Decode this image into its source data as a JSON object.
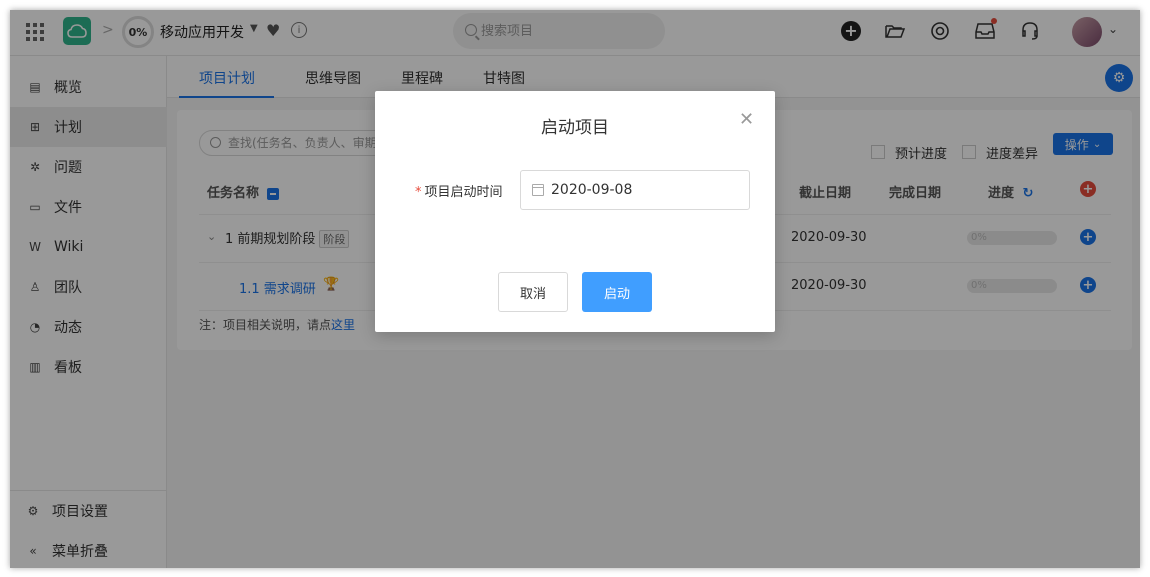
{
  "header": {
    "progress": "0%",
    "project_name": "移动应用开发",
    "search_placeholder": "搜索项目"
  },
  "sidebar": {
    "items": [
      {
        "label": "概览",
        "icon": "overview-icon"
      },
      {
        "label": "计划",
        "icon": "plan-icon",
        "active": true
      },
      {
        "label": "问题",
        "icon": "bug-icon"
      },
      {
        "label": "文件",
        "icon": "folder-icon"
      },
      {
        "label": "Wiki",
        "icon": "wiki-icon"
      },
      {
        "label": "团队",
        "icon": "team-icon"
      },
      {
        "label": "动态",
        "icon": "activity-icon"
      },
      {
        "label": "看板",
        "icon": "board-icon"
      }
    ],
    "settings_label": "项目设置",
    "collapse_label": "菜单折叠"
  },
  "tabs": [
    "项目计划",
    "思维导图",
    "里程碑",
    "甘特图"
  ],
  "plan": {
    "task_search_placeholder": "查找(任务名、负责人、审期",
    "show_planned_progress": "预计进度",
    "show_progress_diff": "进度差异",
    "operations_label": "操作",
    "columns": {
      "task_name": "任务名称",
      "due_date": "截止日期",
      "completion_date": "完成日期",
      "progress": "进度"
    },
    "rows": [
      {
        "name": "1 前期规划阶段",
        "badge": "阶段",
        "due": "2020-09-30",
        "progress": "0%"
      },
      {
        "name": "1.1 需求调研",
        "due": "2020-09-30",
        "progress": "0%"
      }
    ],
    "note_prefix": "注：项目相关说明，请点",
    "note_link": "这里"
  },
  "modal": {
    "title": "启动项目",
    "field_label": "项目启动时间",
    "required_mark": "*",
    "date_value": "2020-09-08",
    "cancel_label": "取消",
    "confirm_label": "启动"
  },
  "colors": {
    "primary": "#1a73e8",
    "confirm_button": "#409eff",
    "logo": "#2fb58c",
    "danger": "#e74c3c"
  }
}
